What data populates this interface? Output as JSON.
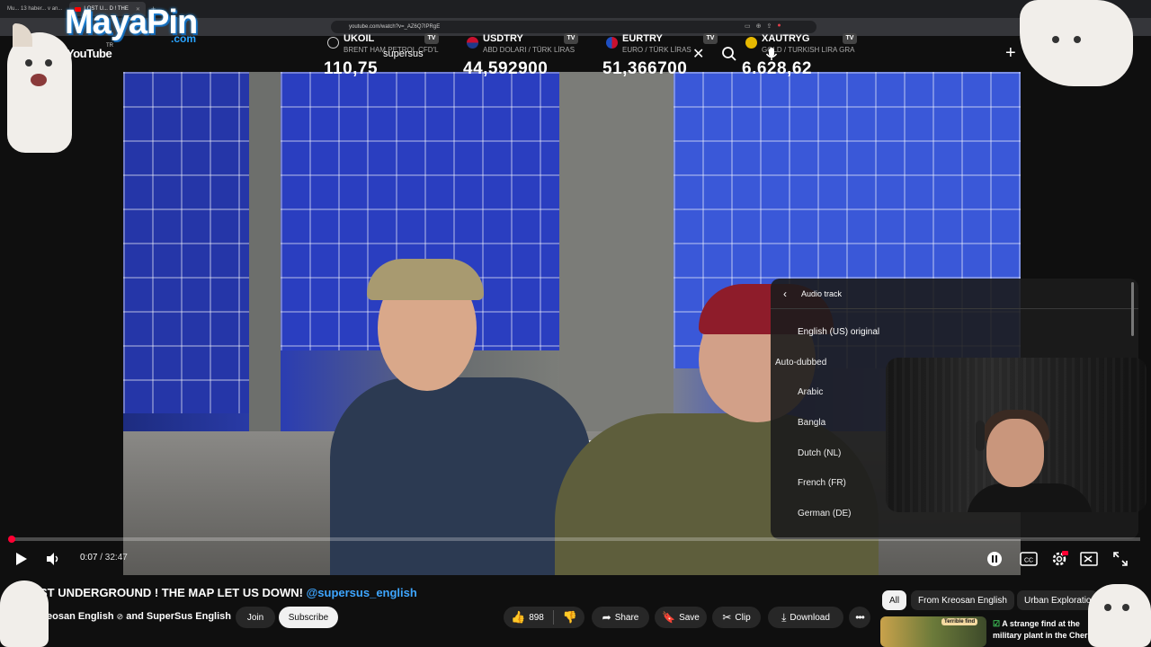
{
  "browser": {
    "tabs": [
      {
        "label": "Mu... 13 haber... v an...",
        "active": false
      },
      {
        "label": "LOST U...  D ! THE",
        "active": true
      }
    ],
    "url": "youtube.com/watch?v=_AZ6Q7IPRgE"
  },
  "overlay": {
    "logo": "MayaPin",
    "logo_suffix": ".com",
    "tickers": [
      {
        "symbol": "UKOIL",
        "name": "BRENT HAM PETROL CFD'L",
        "value": "110,75",
        "flag_color": "#ffffff"
      },
      {
        "symbol": "USDTRY",
        "name": "ABD DOLARI / TÜRK LİRAS",
        "value": "44,592900",
        "flag_color": "#c8102e"
      },
      {
        "symbol": "EURTRY",
        "name": "EURO / TÜRK LİRAS",
        "value": "51,366700",
        "flag_color": "#1e4fc2"
      },
      {
        "symbol": "XAUTRYG",
        "name": "GOLD / TURKISH LIRA GRA",
        "value": "6.628,62",
        "flag_color": "#e6b800"
      }
    ]
  },
  "header": {
    "wordmark": "YouTube",
    "country": "TR",
    "search_value": "supersus"
  },
  "player": {
    "current_time": "0:07",
    "duration": "/ 32:47",
    "progress": 0.004
  },
  "audio_menu": {
    "title": "Audio track",
    "original": "English (US) original",
    "group_label": "Auto-dubbed",
    "languages": [
      "Arabic",
      "Bangla",
      "Dutch (NL)",
      "French (FR)",
      "German (DE)"
    ]
  },
  "video": {
    "title_prefix": "ST UNDERGROUND ! THE MAP LET US DOWN!",
    "title_mention": "@supersus_english",
    "channel": "eosan English",
    "channel_check": "⊘",
    "channel_rest": "and SuperSus English",
    "join_label": "Join",
    "subscribe_label": "Subscribe",
    "like_count": "898",
    "share_label": "Share",
    "save_label": "Save",
    "clip_label": "Clip",
    "download_label": "Download"
  },
  "recommendations": {
    "chips": [
      "All",
      "From Kreosan English",
      "Urban Exploratio"
    ],
    "first_title": "A strange find at the military plant in the Cher",
    "first_badge": "Terrible find"
  }
}
